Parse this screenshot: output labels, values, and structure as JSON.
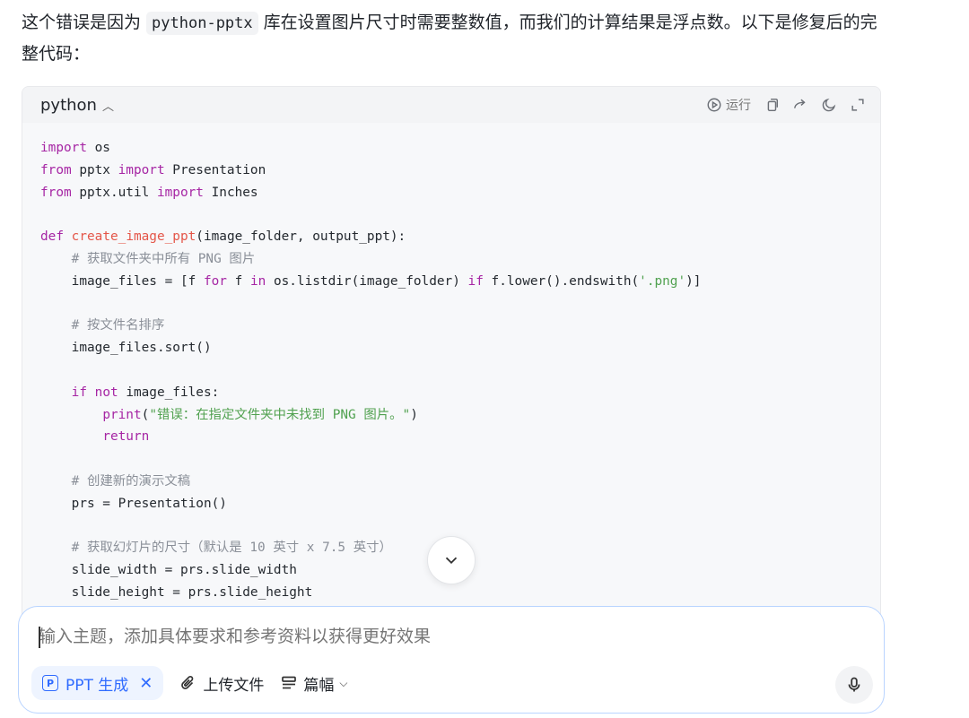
{
  "intro": {
    "part1": "这个错误是因为 ",
    "code": "python-pptx",
    "part2": " 库在设置图片尺寸时需要整数值，而我们的计算结果是浮点数。以下是修复后的完整代码："
  },
  "codeblock": {
    "language": "python",
    "run_label": "运行",
    "lines": [
      [
        [
          "kw",
          "import"
        ],
        [
          "t",
          " os"
        ]
      ],
      [
        [
          "kw",
          "from"
        ],
        [
          "t",
          " pptx "
        ],
        [
          "kw",
          "import"
        ],
        [
          "t",
          " Presentation"
        ]
      ],
      [
        [
          "kw",
          "from"
        ],
        [
          "t",
          " pptx.util "
        ],
        [
          "kw",
          "import"
        ],
        [
          "t",
          " Inches"
        ]
      ],
      [],
      [
        [
          "kw",
          "def"
        ],
        [
          "t",
          " "
        ],
        [
          "fn",
          "create_image_ppt"
        ],
        [
          "t",
          "(image_folder, output_ppt):"
        ]
      ],
      [
        [
          "t",
          "    "
        ],
        [
          "cm",
          "# 获取文件夹中所有 PNG 图片"
        ]
      ],
      [
        [
          "t",
          "    image_files = [f "
        ],
        [
          "kw",
          "for"
        ],
        [
          "t",
          " f "
        ],
        [
          "kw",
          "in"
        ],
        [
          "t",
          " os.listdir(image_folder) "
        ],
        [
          "kw",
          "if"
        ],
        [
          "t",
          " f.lower().endswith("
        ],
        [
          "st",
          "'.png'"
        ],
        [
          "t",
          ")]"
        ]
      ],
      [],
      [
        [
          "t",
          "    "
        ],
        [
          "cm",
          "# 按文件名排序"
        ]
      ],
      [
        [
          "t",
          "    image_files.sort()"
        ]
      ],
      [],
      [
        [
          "t",
          "    "
        ],
        [
          "kw",
          "if"
        ],
        [
          "t",
          " "
        ],
        [
          "kw",
          "not"
        ],
        [
          "t",
          " image_files:"
        ]
      ],
      [
        [
          "t",
          "        "
        ],
        [
          "kw",
          "print"
        ],
        [
          "t",
          "("
        ],
        [
          "st",
          "\"错误：在指定文件夹中未找到 PNG 图片。\""
        ],
        [
          "t",
          ")"
        ]
      ],
      [
        [
          "t",
          "        "
        ],
        [
          "kw",
          "return"
        ]
      ],
      [],
      [
        [
          "t",
          "    "
        ],
        [
          "cm",
          "# 创建新的演示文稿"
        ]
      ],
      [
        [
          "t",
          "    prs = Presentation()"
        ]
      ],
      [],
      [
        [
          "t",
          "    "
        ],
        [
          "cm",
          "# 获取幻灯片的尺寸（默认是 10 英寸 x 7.5 英寸）"
        ]
      ],
      [
        [
          "t",
          "    slide_width = prs.slide_width"
        ]
      ],
      [
        [
          "t",
          "    slide_height = prs.slide_height"
        ]
      ]
    ]
  },
  "composer": {
    "placeholder": "输入主题，添加具体要求和参考资料以获得更好效果",
    "ppt_chip_icon": "P",
    "ppt_chip_label": "PPT 生成",
    "upload_label": "上传文件",
    "length_label": "篇幅"
  }
}
